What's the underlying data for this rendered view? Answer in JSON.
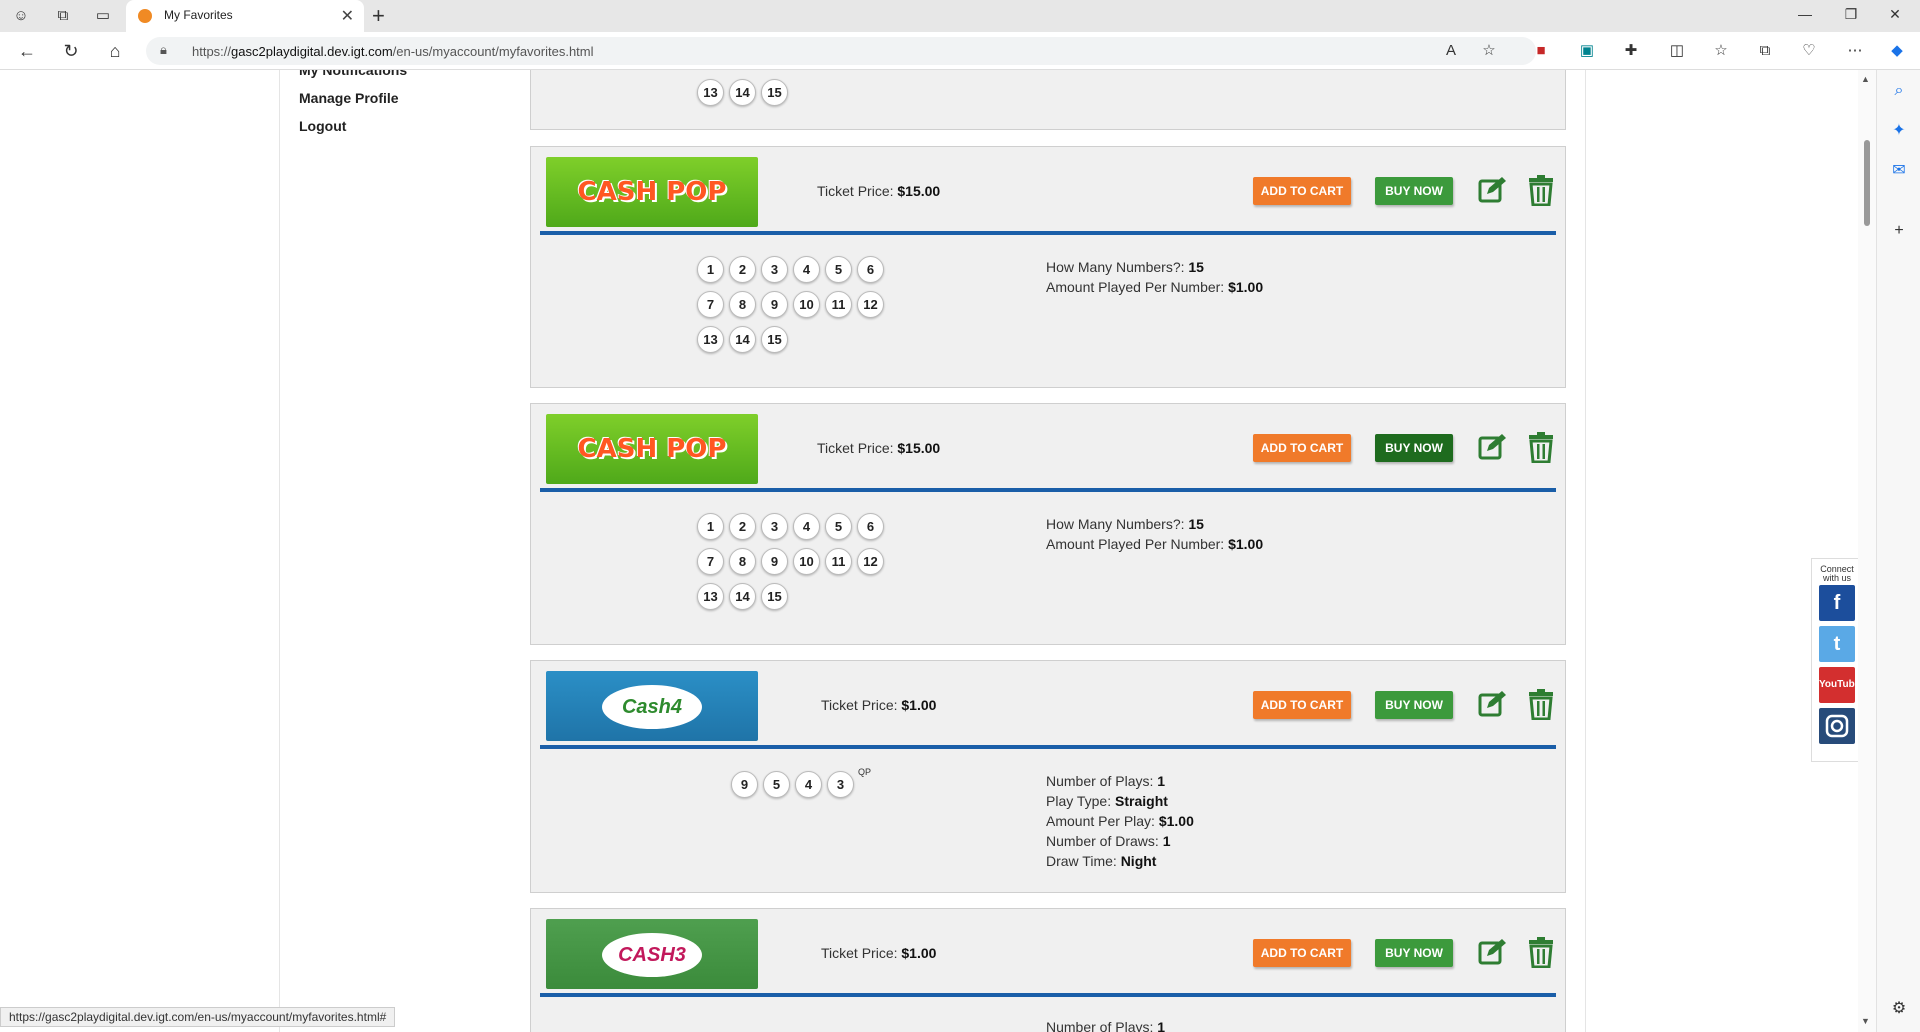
{
  "browser": {
    "tab_title": "My Favorites",
    "url_prefix": "https://",
    "url_host": "gasc2playdigital.dev.igt.com",
    "url_path": "/en-us/myaccount/myfavorites.html",
    "status_url": "https://gasc2playdigital.dev.igt.com/en-us/myaccount/myfavorites.html#"
  },
  "sidebar": {
    "items": [
      "My Notifications",
      "Manage Profile",
      "Logout"
    ]
  },
  "labels": {
    "ticket_price": "Ticket Price:",
    "add_to_cart": "ADD TO CART",
    "buy_now": "BUY NOW",
    "qp": "QP"
  },
  "top_partial": {
    "numbers": [
      "13",
      "14",
      "15"
    ]
  },
  "cards": [
    {
      "game": "Cash Pop",
      "logo_text": "CASH POP",
      "price": "$15.00",
      "numbers": [
        "1",
        "2",
        "3",
        "4",
        "5",
        "6",
        "7",
        "8",
        "9",
        "10",
        "11",
        "12",
        "13",
        "14",
        "15"
      ],
      "details": [
        {
          "label": "How Many Numbers?:",
          "value": "15"
        },
        {
          "label": "Amount Played Per Number:",
          "value": "$1.00"
        }
      ]
    },
    {
      "game": "Cash Pop",
      "logo_text": "CASH POP",
      "price": "$15.00",
      "numbers": [
        "1",
        "2",
        "3",
        "4",
        "5",
        "6",
        "7",
        "8",
        "9",
        "10",
        "11",
        "12",
        "13",
        "14",
        "15"
      ],
      "details": [
        {
          "label": "How Many Numbers?:",
          "value": "15"
        },
        {
          "label": "Amount Played Per Number:",
          "value": "$1.00"
        }
      ]
    },
    {
      "game": "Cash 4",
      "logo_text": "Cash4",
      "price": "$1.00",
      "numbers": [
        "9",
        "5",
        "4",
        "3"
      ],
      "details": [
        {
          "label": "Number of Plays:",
          "value": "1"
        },
        {
          "label": "Play Type:",
          "value": "Straight"
        },
        {
          "label": "Amount Per Play:",
          "value": "$1.00"
        },
        {
          "label": "Number of Draws:",
          "value": "1"
        },
        {
          "label": "Draw Time:",
          "value": "Night"
        }
      ]
    },
    {
      "game": "Cash 3",
      "logo_text": "CASH3",
      "price": "$1.00",
      "details": [
        {
          "label": "Number of Plays:",
          "value": "1"
        }
      ]
    }
  ],
  "social": {
    "title": "Connect with us",
    "items": [
      "f",
      "t",
      "YouTube",
      "instagram"
    ]
  },
  "colors": {
    "divider": "#1a5ea8",
    "add_to_cart": "#f07a2a",
    "buy_now": "#3c9a3c",
    "icon_green": "#2e7d32"
  }
}
